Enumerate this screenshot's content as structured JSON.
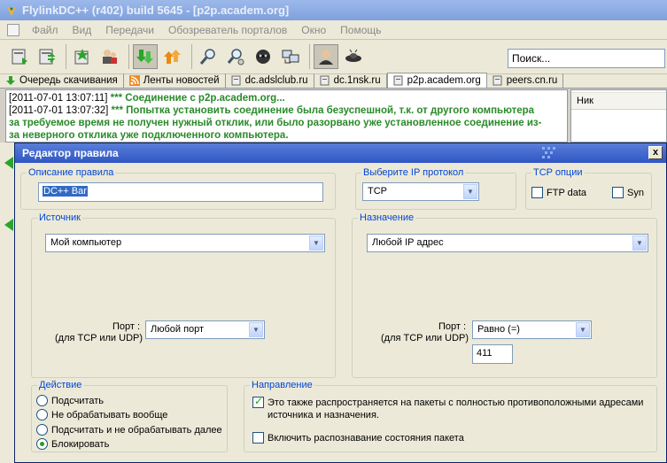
{
  "window": {
    "title": "FlylinkDC++ (r402) build 5645 - [p2p.academ.org]"
  },
  "menu": [
    "Файл",
    "Вид",
    "Передачи",
    "Обозреватель порталов",
    "Окно",
    "Помощь"
  ],
  "search": {
    "placeholder": "Поиск..."
  },
  "tabs": [
    {
      "label": "Очередь скачивания",
      "icon": "download-queue-icon"
    },
    {
      "label": "Ленты новостей",
      "icon": "rss-icon"
    },
    {
      "label": "dc.adslclub.ru",
      "icon": "hub-icon"
    },
    {
      "label": "dc.1nsk.ru",
      "icon": "hub-icon"
    },
    {
      "label": "p2p.academ.org",
      "icon": "hub-icon",
      "active": true
    },
    {
      "label": "peers.cn.ru",
      "icon": "hub-icon"
    }
  ],
  "chat": {
    "lines": [
      {
        "ts": "[2011-07-01 13:07:11]",
        "text": "*** Соединение с p2p.academ.org..."
      },
      {
        "ts": "[2011-07-01 13:07:32]",
        "text": "*** Попытка установить соединение была безуспешной, т.к. от другого компьютера"
      },
      {
        "ts": "",
        "text": "за требуемое время не получен нужный отклик, или было разорвано уже установленное соединение из-"
      },
      {
        "ts": "",
        "text": "за неверного отклика уже подключенного компьютера."
      }
    ]
  },
  "userlist": {
    "header": "Ник"
  },
  "dialog": {
    "title": "Редактор правила",
    "close": "x",
    "description": {
      "legend": "Описание правила",
      "value": "DC++ Bar"
    },
    "protocol": {
      "legend": "Выберите IP протокол",
      "value": "TCP"
    },
    "tcp_options": {
      "legend": "TCP опции",
      "ftp": "FTP data",
      "syn": "Syn"
    },
    "source": {
      "legend": "Источник",
      "value": "Мой компьютер",
      "port_label_1": "Порт :",
      "port_label_2": "(для TCP или UDP)",
      "port_value": "Любой порт"
    },
    "destination": {
      "legend": "Назначение",
      "value": "Любой IP адрес",
      "port_label_1": "Порт :",
      "port_label_2": "(для TCP или UDP)",
      "port_value": "Равно (=)",
      "port_number": "411"
    },
    "action": {
      "legend": "Действие",
      "options": [
        "Подсчитать",
        "Не обрабатывать вообще",
        "Подсчитать и не обрабатывать далее",
        "Блокировать"
      ],
      "selected": 3
    },
    "direction": {
      "legend": "Направление",
      "mirror_1": "Это также распространяется на пакеты с полностью противоположными адресами",
      "mirror_2": "источника и назначения.",
      "mirror_checked": true,
      "state": "Включить распознавание состояния пакета",
      "state_checked": false
    }
  },
  "colors": {
    "accent": "#0046d5",
    "chat_system": "#2a8a2a",
    "dialog_title": "#2f56c4"
  }
}
